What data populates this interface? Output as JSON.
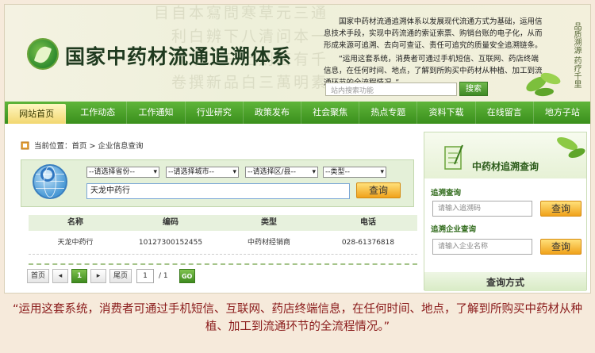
{
  "header": {
    "site_title": "国家中药材流通追溯体系",
    "intro_p1": "国家中药材流通追溯体系以发展现代流通方式为基础，运用信息技术手段，实现中药流通的索证索票、购销台账的电子化，从而形成来源可追溯、去向可查证、责任可追究的质量安全追溯链条。",
    "intro_p2": "“运用这套系统，消费者可通过手机短信、互联网、药店终端信息，在任何时间、地点，了解到所购买中药材从种植、加工到流通环节的全流程情况。”",
    "search_placeholder": "站内搜索功能",
    "search_button": "搜索",
    "slogan": "品质溯源 药疗千里",
    "bg_text": "通 一 千 素 三 本 有 明 元 问 苦 萬 草 清 則 三 寒 八 上 白 問 下 三 品 寫 辨 上 新 本 白 下 撰 自 利 温 卷 目"
  },
  "nav": {
    "items": [
      "网站首页",
      "工作动态",
      "工作通知",
      "行业研究",
      "政策发布",
      "社会聚焦",
      "热点专题",
      "资料下载",
      "在线留言",
      "地方子站"
    ],
    "active_index": 0
  },
  "main": {
    "breadcrumb": "当前位置：首页 > 企业信息查询",
    "filters": {
      "province": "--请选择省份--",
      "city": "--请选择城市--",
      "district": "--请选择区/县--",
      "type": "--类型--"
    },
    "query_value": "天龙中药行",
    "query_button": "查询",
    "table": {
      "headers": [
        "名称",
        "编码",
        "类型",
        "电话"
      ],
      "rows": [
        [
          "天龙中药行",
          "10127300152455",
          "中药材经销商",
          "028-61376818"
        ]
      ]
    },
    "pager": {
      "first": "首页",
      "prev": "◂",
      "current": "1",
      "next": "▸",
      "last": "尾页",
      "page_input": "1",
      "total": "/ 1",
      "go": "GO"
    }
  },
  "sidebar": {
    "title": "中药材追溯查询",
    "trace_label": "追溯查询",
    "trace_placeholder": "请输入追溯码",
    "trace_button": "查询",
    "company_label": "追溯企业查询",
    "company_placeholder": "请输入企业名称",
    "company_button": "查询",
    "footer": "查询方式"
  },
  "caption": "“运用这套系统，消费者可通过手机短信、互联网、药店终端信息，在任何时间、地点，了解到所购买中药材从种植、加工到流通环节的全流程情况。”",
  "colors": {
    "nav_green": "#4aa229",
    "button_orange": "#f0a21b",
    "caption_red": "#8a1a1a",
    "page_bg": "#f6eadb"
  }
}
